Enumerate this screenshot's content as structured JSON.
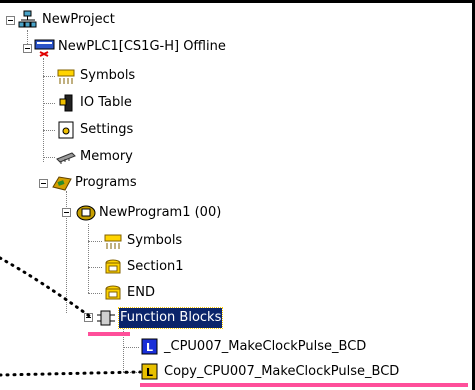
{
  "tree": {
    "project": {
      "label": "NewProject",
      "icon": "network-icon"
    },
    "plc": {
      "label": "NewPLC1[CS1G-H] Offline",
      "icon": "plc-offline-icon"
    },
    "plc_children": [
      {
        "label": "Symbols",
        "icon": "symbols-icon"
      },
      {
        "label": "IO Table",
        "icon": "io-table-icon"
      },
      {
        "label": "Settings",
        "icon": "settings-icon"
      },
      {
        "label": "Memory",
        "icon": "memory-icon"
      }
    ],
    "programs": {
      "label": "Programs",
      "icon": "programs-icon"
    },
    "program1": {
      "label": "NewProgram1 (00)",
      "icon": "program-icon"
    },
    "program1_children": [
      {
        "label": "Symbols",
        "icon": "symbols-icon"
      },
      {
        "label": "Section1",
        "icon": "section-icon"
      },
      {
        "label": "END",
        "icon": "end-section-icon"
      }
    ],
    "function_blocks": {
      "label": "Function Blocks",
      "icon": "function-blocks-icon"
    },
    "fb_children": [
      {
        "label": "_CPU007_MakeClockPulse_BCD",
        "icon": "fb-ladder-icon"
      },
      {
        "label": "Copy_CPU007_MakeClockPulse_BCD",
        "icon": "fb-st-icon"
      }
    ]
  },
  "colors": {
    "selection_bg": "#0a246a",
    "pink_underline": "#ff4f9a",
    "dotted_callout": "#000000"
  }
}
